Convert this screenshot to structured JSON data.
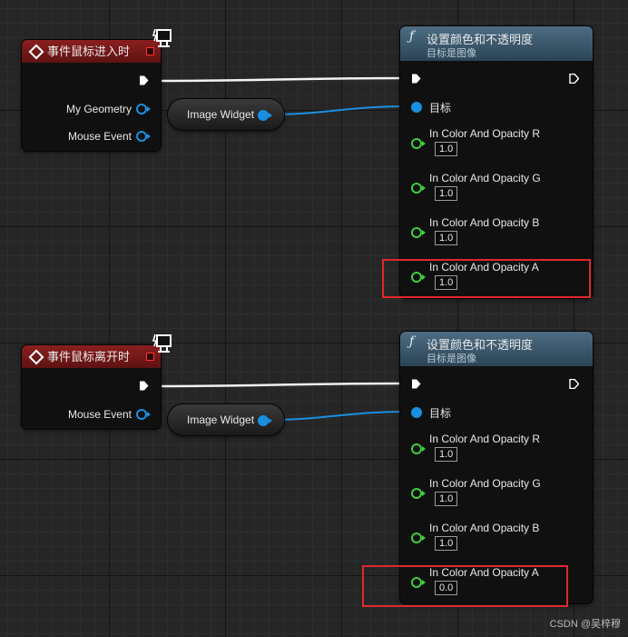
{
  "graph_a": {
    "event_node": {
      "title": "事件鼠标进入时",
      "pins": [
        "My Geometry",
        "Mouse Event"
      ]
    },
    "variable_node": {
      "label": "Image Widget"
    },
    "function_node": {
      "title": "设置颜色和不透明度",
      "subtitle": "目标是图像",
      "target_label": "目标",
      "params": [
        {
          "label": "In Color And Opacity R",
          "value": "1.0"
        },
        {
          "label": "In Color And Opacity G",
          "value": "1.0"
        },
        {
          "label": "In Color And Opacity B",
          "value": "1.0"
        },
        {
          "label": "In Color And Opacity A",
          "value": "1.0"
        }
      ]
    }
  },
  "graph_b": {
    "event_node": {
      "title": "事件鼠标离开时",
      "pins": [
        "Mouse Event"
      ]
    },
    "variable_node": {
      "label": "Image Widget"
    },
    "function_node": {
      "title": "设置颜色和不透明度",
      "subtitle": "目标是图像",
      "target_label": "目标",
      "params": [
        {
          "label": "In Color And Opacity R",
          "value": "1.0"
        },
        {
          "label": "In Color And Opacity G",
          "value": "1.0"
        },
        {
          "label": "In Color And Opacity B",
          "value": "1.0"
        },
        {
          "label": "In Color And Opacity A",
          "value": "0.0"
        }
      ]
    }
  },
  "colors": {
    "event_header": "#7a1a1a",
    "function_header": "#3c5a70",
    "object_pin": "#1a8fe0",
    "struct_pin": "#3fcf3f",
    "highlight": "#e0282a"
  },
  "watermark": "CSDN @吴梓穆"
}
